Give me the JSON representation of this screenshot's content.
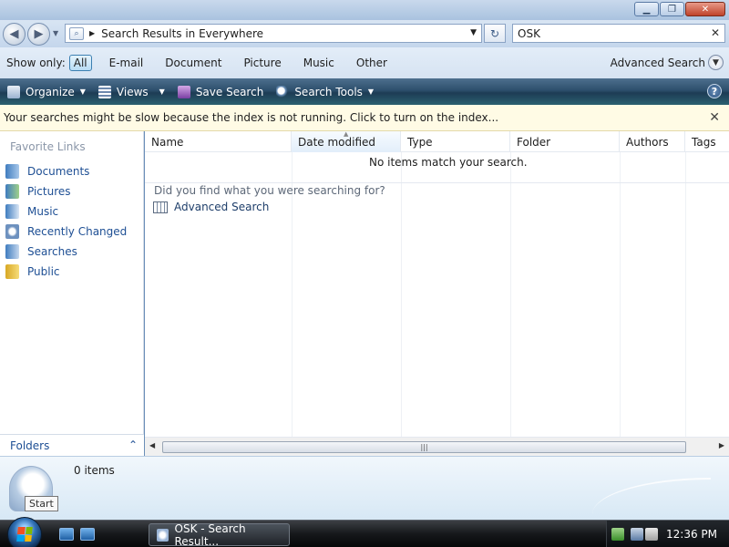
{
  "window": {
    "minimize_glyph": "▁",
    "maximize_glyph": "❐",
    "close_glyph": "✕"
  },
  "address_bar": {
    "path_icon": "search-folder-icon",
    "breadcrumb": "Search Results in Everywhere",
    "search_value": "OSK"
  },
  "filter_bar": {
    "label": "Show only:",
    "items": [
      "All",
      "E-mail",
      "Document",
      "Picture",
      "Music",
      "Other"
    ],
    "active": "All",
    "advanced_search": "Advanced Search"
  },
  "command_bar": {
    "organize": "Organize",
    "views": "Views",
    "save_search": "Save Search",
    "search_tools": "Search Tools",
    "help_glyph": "?"
  },
  "info_bar": {
    "message": "Your searches might be slow because the index is not running.  Click to turn on the index..."
  },
  "nav_pane": {
    "favorite_links_title": "Favorite Links",
    "items": [
      {
        "label": "Documents",
        "icon": "documents-icon"
      },
      {
        "label": "Pictures",
        "icon": "pictures-icon"
      },
      {
        "label": "Music",
        "icon": "music-icon"
      },
      {
        "label": "Recently Changed",
        "icon": "recently-changed-icon"
      },
      {
        "label": "Searches",
        "icon": "searches-icon"
      },
      {
        "label": "Public",
        "icon": "public-folder-icon"
      }
    ],
    "folders_label": "Folders"
  },
  "file_list": {
    "columns": [
      "Name",
      "Date modified",
      "Type",
      "Folder",
      "Authors",
      "Tags"
    ],
    "sorted_column": "Date modified",
    "empty_message": "No items match your search.",
    "find_prompt": "Did you find what you were searching for?",
    "advanced_search_link": "Advanced Search"
  },
  "details_pane": {
    "count": "0 items",
    "tooltip": "Start"
  },
  "taskbar": {
    "task_button": "OSK - Search Result...",
    "clock": "12:36 PM"
  },
  "colors": {
    "link_blue": "#1e4f94",
    "command_bar": "#2d4f6c",
    "info_bar_bg": "#fffbe5"
  }
}
